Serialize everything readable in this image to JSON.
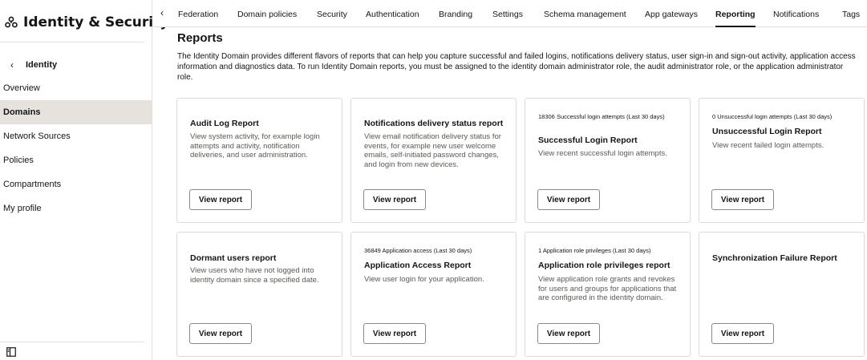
{
  "sidebar": {
    "app_title": "Identity & Security",
    "app_icon": "identity-security-icon",
    "back_label": "Identity",
    "items": [
      {
        "label": "Overview",
        "active": false
      },
      {
        "label": "Domains",
        "active": true
      },
      {
        "label": "Network Sources",
        "active": false
      },
      {
        "label": "Policies",
        "active": false
      },
      {
        "label": "Compartments",
        "active": false
      },
      {
        "label": "My profile",
        "active": false
      }
    ]
  },
  "tabs": {
    "items": [
      {
        "label": "Federation"
      },
      {
        "label": "Domain policies"
      },
      {
        "label": "Security"
      },
      {
        "label": "Authentication"
      },
      {
        "label": "Branding"
      },
      {
        "label": "Settings"
      },
      {
        "label": "Schema management"
      },
      {
        "label": "App gateways"
      },
      {
        "label": "Reporting",
        "active": true
      },
      {
        "label": "Notifications"
      },
      {
        "label": "Tags"
      }
    ]
  },
  "main": {
    "title": "Reports",
    "description": "The Identity Domain provides different flavors of reports that can help you capture successful and failed logins, notifications delivery status, user sign-in and sign-out activity, application access information and diagnostics data. To run Identity Domain reports, you must be assigned to the identity domain administrator role, the audit administrator role, or the application administrator role.",
    "view_report_label": "View report",
    "cards": [
      {
        "kicker": "",
        "title": "Audit Log Report",
        "description": "View system activity, for example login attempts and activity, notification deliveries, and user administration."
      },
      {
        "kicker": "",
        "title": "Notifications delivery status report",
        "description": "View email notification delivery status for events, for example new user welcome emails, self-initiated password changes, and login from new devices."
      },
      {
        "kicker": "18306 Successful login attempts (Last 30 days)",
        "title": "Successful Login Report",
        "description": "View recent successful login attempts."
      },
      {
        "kicker": "0 Unsuccessful login attempts (Last 30 days)",
        "title": "Unsuccessful Login Report",
        "description": "View recent failed login attempts."
      },
      {
        "kicker": "",
        "title": "Dormant users report",
        "description": "View users who have not logged into identity domain since a specified date."
      },
      {
        "kicker": "36849 Application access (Last 30 days)",
        "title": "Application Access Report",
        "description": "View user login for your application."
      },
      {
        "kicker": "1 Application role privileges (Last 30 days)",
        "title": "Application role privileges report",
        "description": "View application role grants and revokes for users and groups for applications that are configured in the identity domain."
      },
      {
        "kicker": "",
        "title": "Synchronization Failure Report",
        "description": ""
      }
    ]
  }
}
